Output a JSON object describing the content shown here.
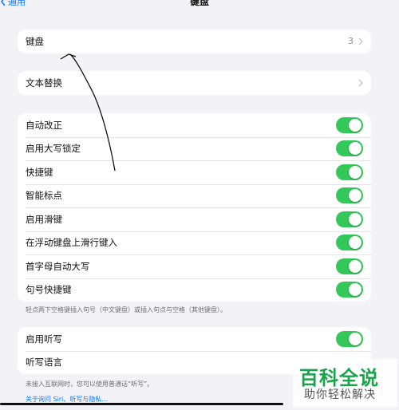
{
  "nav": {
    "back_label": "通用",
    "title": "键盘"
  },
  "groups": {
    "keyboards": {
      "label": "键盘",
      "value": "3"
    },
    "text_replacement": {
      "label": "文本替换"
    },
    "toggles": [
      {
        "label": "自动改正",
        "on": true
      },
      {
        "label": "启用大写锁定",
        "on": true
      },
      {
        "label": "快捷键",
        "on": true
      },
      {
        "label": "智能标点",
        "on": true
      },
      {
        "label": "启用滑键",
        "on": true
      },
      {
        "label": "在浮动键盘上滑行键入",
        "on": true
      },
      {
        "label": "首字母自动大写",
        "on": true
      },
      {
        "label": "句号快捷键",
        "on": true
      }
    ],
    "toggles_note": "轻点两下空格键插入句号（中文键盘）或插入句点与空格（其他键盘）。",
    "dictation": {
      "enable_label": "启用听写",
      "enable_on": true,
      "language_label": "听写语言"
    },
    "dictation_note": "未接入互联网时，您可以使用普通话“听写”。",
    "privacy_link": "关于询问 Siri、听写与隐私..."
  },
  "watermark": {
    "main": "百科全说",
    "sub": "助你轻松解决"
  },
  "colors": {
    "accent": "#0a7aff",
    "toggle_on": "#34c759",
    "background": "#f2f2f7",
    "watermark_green": "#1aa34a"
  }
}
